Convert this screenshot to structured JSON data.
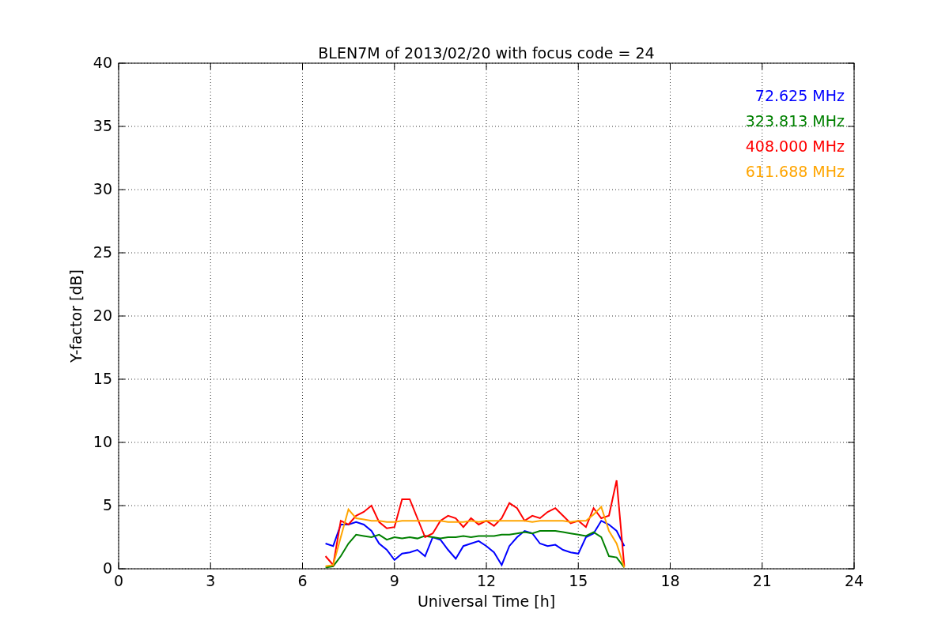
{
  "chart_data": {
    "type": "line",
    "grid": true,
    "title": "BLEN7M of 2013/02/20 with focus code = 24",
    "xlabel": "Universal Time [h]",
    "ylabel": "Y-factor [dB]",
    "xlim": [
      0,
      24
    ],
    "ylim": [
      0,
      40
    ],
    "xticks": [
      0,
      3,
      6,
      9,
      12,
      15,
      18,
      21,
      24
    ],
    "yticks": [
      0,
      5,
      10,
      15,
      20,
      25,
      30,
      35,
      40
    ],
    "x": [
      6.75,
      7,
      7.25,
      7.5,
      7.75,
      8,
      8.25,
      8.5,
      8.75,
      9,
      9.25,
      9.5,
      9.75,
      10,
      10.25,
      10.5,
      10.75,
      11,
      11.25,
      11.5,
      11.75,
      12,
      12.25,
      12.5,
      12.75,
      13,
      13.25,
      13.5,
      13.75,
      14,
      14.25,
      14.5,
      14.75,
      15,
      15.25,
      15.5,
      15.75,
      16,
      16.25,
      16.5
    ],
    "series": [
      {
        "name": "72.625 MHz",
        "color": "#0000ff",
        "values": [
          2,
          1.8,
          3.5,
          3.5,
          3.7,
          3.5,
          3,
          2,
          1.5,
          0.7,
          1.2,
          1.3,
          1.5,
          1,
          2.5,
          2.3,
          1.5,
          0.8,
          1.8,
          2,
          2.2,
          1.8,
          1.3,
          0.3,
          1.8,
          2.5,
          3,
          2.8,
          2,
          1.8,
          1.9,
          1.5,
          1.3,
          1.2,
          2.5,
          2.8,
          3.8,
          3.5,
          3,
          1.8
        ]
      },
      {
        "name": "323.813 MHz",
        "color": "#008000",
        "values": [
          0.1,
          0.2,
          1,
          2,
          2.7,
          2.6,
          2.5,
          2.7,
          2.3,
          2.5,
          2.4,
          2.5,
          2.4,
          2.6,
          2.5,
          2.4,
          2.5,
          2.5,
          2.6,
          2.5,
          2.6,
          2.6,
          2.6,
          2.7,
          2.7,
          2.8,
          2.9,
          2.8,
          3,
          3,
          3,
          2.9,
          2.8,
          2.7,
          2.6,
          2.9,
          2.5,
          1,
          0.9,
          0.1
        ]
      },
      {
        "name": "408.000 MHz",
        "color": "#ff0000",
        "values": [
          1,
          0.3,
          3.8,
          3.5,
          4.2,
          4.5,
          5,
          3.7,
          3.2,
          3.3,
          5.5,
          5.5,
          4,
          2.5,
          2.8,
          3.8,
          4.2,
          4,
          3.3,
          4,
          3.5,
          3.8,
          3.4,
          4,
          5.2,
          4.8,
          3.8,
          4.2,
          4,
          4.5,
          4.8,
          4.2,
          3.6,
          3.8,
          3.3,
          4.8,
          4,
          4.2,
          7,
          0.2
        ]
      },
      {
        "name": "611.688 MHz",
        "color": "#ffa500",
        "values": [
          0.2,
          0.3,
          2.5,
          4.7,
          4,
          3.9,
          3.8,
          3.8,
          3.7,
          3.7,
          3.8,
          3.8,
          3.8,
          3.8,
          3.8,
          3.8,
          3.7,
          3.7,
          3.7,
          3.8,
          3.7,
          3.8,
          3.8,
          3.8,
          3.8,
          3.8,
          3.8,
          3.7,
          3.8,
          3.8,
          3.8,
          3.8,
          3.7,
          3.8,
          3.8,
          4.3,
          4.9,
          3,
          2,
          0.1
        ]
      }
    ]
  }
}
